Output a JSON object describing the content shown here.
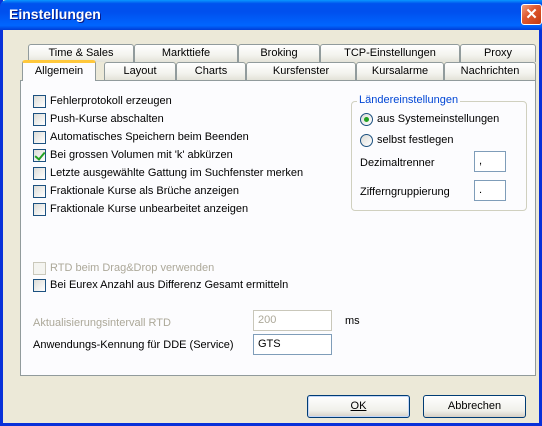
{
  "window": {
    "title": "Einstellungen"
  },
  "tabs_row1": [
    {
      "label": "Time & Sales"
    },
    {
      "label": "Markttiefe"
    },
    {
      "label": "Broking"
    },
    {
      "label": "TCP-Einstellungen"
    },
    {
      "label": "Proxy"
    }
  ],
  "tabs_row2": [
    {
      "label": "Allgemein",
      "active": true
    },
    {
      "label": "Layout"
    },
    {
      "label": "Charts"
    },
    {
      "label": "Kursfenster"
    },
    {
      "label": "Kursalarme"
    },
    {
      "label": "Nachrichten"
    }
  ],
  "options": [
    {
      "label": "Fehlerprotokoll erzeugen",
      "checked": false
    },
    {
      "label": "Push-Kurse abschalten",
      "checked": false
    },
    {
      "label": "Automatisches Speichern beim Beenden",
      "checked": false
    },
    {
      "label": "Bei grossen Volumen mit 'k' abkürzen",
      "checked": true
    },
    {
      "label": "Letzte ausgewählte Gattung im Suchfenster merken",
      "checked": false
    },
    {
      "label": "Fraktionale Kurse als Brüche anzeigen",
      "checked": false
    },
    {
      "label": "Fraktionale Kurse unbearbeitet anzeigen",
      "checked": false
    }
  ],
  "rtd_drag": {
    "label": "RTD beim Drag&Drop verwenden",
    "checked": false,
    "disabled": true
  },
  "eurex": {
    "label": "Bei Eurex Anzahl aus Differenz Gesamt ermitteln",
    "checked": false
  },
  "country": {
    "title": "Ländereinstellungen",
    "radio_system": "aus Systemeinstellungen",
    "radio_custom": "selbst festlegen",
    "selected": "system",
    "decimal_label": "Dezimaltrenner",
    "decimal_value": ",",
    "grouping_label": "Zifferngruppierung",
    "grouping_value": "."
  },
  "rtd_interval": {
    "label": "Aktualisierungsintervall RTD",
    "value": "200",
    "unit": "ms"
  },
  "dde": {
    "label": "Anwendungs-Kennung für DDE (Service)",
    "value": "GTS"
  },
  "buttons": {
    "ok": "OK",
    "cancel": "Abbrechen"
  }
}
